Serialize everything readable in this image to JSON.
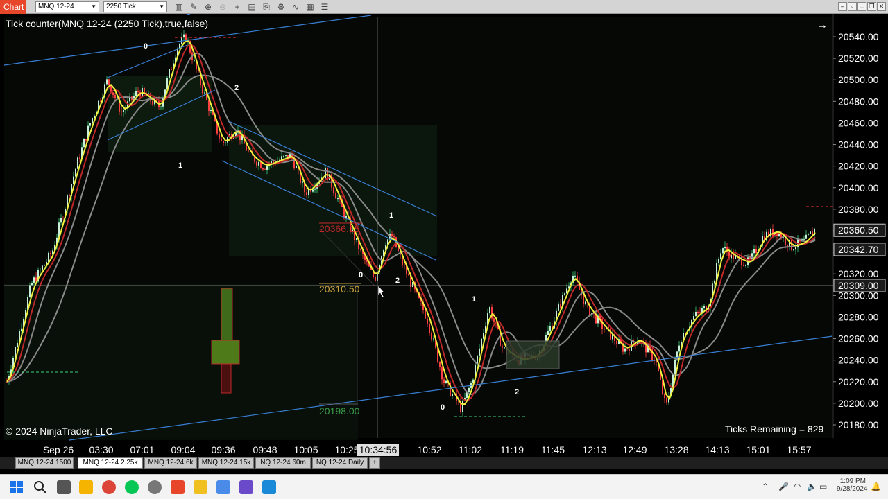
{
  "toolbar": {
    "app_tab": "Chart",
    "instrument": "MNQ 12-24",
    "interval": "2250 Tick",
    "icons": [
      "bar-style-icon",
      "draw-icon",
      "zoom-in-icon",
      "zoom-out-icon",
      "crosshair-icon",
      "properties-icon",
      "template-icon",
      "strategy-icon",
      "indicator-icon",
      "data-box-icon",
      "chart-trader-icon"
    ],
    "window_icons": [
      "minimize-icon",
      "tile-icon",
      "restore-icon",
      "maximize-icon",
      "close-icon"
    ]
  },
  "chart": {
    "indicator_label": "Tick counter(MNQ 12-24 (2250 Tick),true,false)",
    "copyright": "© 2024 NinjaTrader, LLC",
    "ticks_remaining": "Ticks Remaining = 829",
    "price_labels": [
      "20540.00",
      "20520.00",
      "20500.00",
      "20480.00",
      "20460.00",
      "20440.00",
      "20420.00",
      "20400.00",
      "20380.00",
      "20360.00",
      "20340.00",
      "20320.00",
      "20300.00",
      "20280.00",
      "20260.00",
      "20240.00",
      "20220.00",
      "20200.00",
      "20180.00"
    ],
    "price_tags": {
      "current": "20360.50",
      "ma": "20342.70",
      "crosshair": "20309.00"
    },
    "time_labels": [
      "Sep 26",
      "03:30",
      "07:01",
      "09:04",
      "09:36",
      "09:48",
      "10:05",
      "10:25",
      "10:52",
      "11:02",
      "11:19",
      "11:45",
      "12:13",
      "12:49",
      "13:28",
      "14:13",
      "15:01",
      "15:57"
    ],
    "crosshair_time": "10:34:56",
    "annotations": {
      "level_high": "20366.15",
      "level_mid": "20310.50",
      "level_low": "20198.00"
    },
    "wave_labels": [
      "0",
      "2",
      "1",
      "1",
      "0",
      "2",
      "1",
      "2",
      "0"
    ],
    "colors": {
      "bull": "#3cd07a",
      "bear": "#ff4040",
      "fast_ma": "#f2f23c",
      "mid_ma": "#c0282a",
      "slow_ma": "#8a8a8a",
      "channel": "#3a7fd6"
    }
  },
  "tabs": [
    "MNQ 12-24 1500",
    "MNQ 12-24 2.25k",
    "MNQ 12-24 6k",
    "MNQ 12-24 15k",
    "NQ 12-24 60m",
    "NQ 12-24 Daily",
    "+"
  ],
  "active_tab": "MNQ 12-24 2.25k",
  "taskbar": {
    "time": "1:09 PM",
    "date": "9/28/2024"
  }
}
